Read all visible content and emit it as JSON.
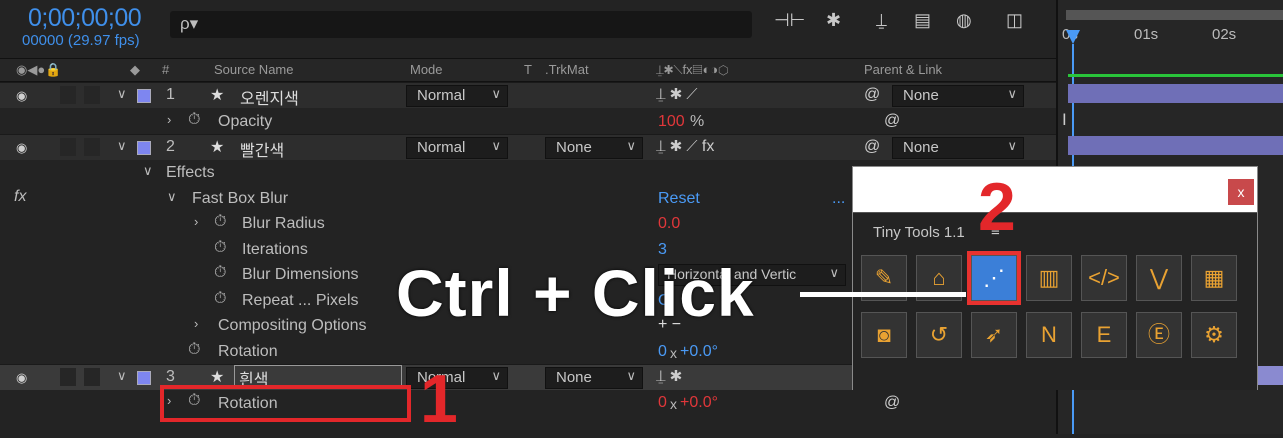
{
  "topbar": {
    "timecode": "0;00;00;00",
    "fps": "00000 (29.97 fps)",
    "search_icon": "ρ▾"
  },
  "columns": {
    "source_name": "Source Name",
    "mode": "Mode",
    "t": "T",
    "trkmat": ".TrkMat",
    "parent_link": "Parent & Link",
    "hash": "#"
  },
  "timeline": {
    "ruler": [
      "0s",
      "01s",
      "02s"
    ],
    "ibeam": "I"
  },
  "layers": [
    {
      "num": "1",
      "name": "오렌지색",
      "mode": "Normal",
      "trkmat": "",
      "parent": "None",
      "color": "#7e86f0"
    },
    {
      "num": "2",
      "name": "빨간색",
      "mode": "Normal",
      "trkmat": "None",
      "parent": "None",
      "color": "#7e86f0"
    },
    {
      "num": "3",
      "name": "흰색",
      "mode": "Normal",
      "trkmat": "None",
      "parent": "",
      "color": "#7e86f0"
    }
  ],
  "props": {
    "opacity_label": "Opacity",
    "opacity_value_num": "100",
    "opacity_value_unit": "%",
    "effects": "Effects",
    "fx": "fx",
    "fast_box_blur": "Fast Box Blur",
    "reset": "Reset",
    "dots": "...",
    "blur_radius": "Blur Radius",
    "blur_radius_value": "0.0",
    "iterations": "Iterations",
    "iterations_value": "3",
    "blur_dimensions": "Blur Dimensions",
    "blur_dimensions_value": "Horizontal and Vertic",
    "repeat_pixels": "Repeat ... Pixels",
    "repeat_value": "O",
    "compositing": "Compositing Options",
    "compositing_value": "+ −",
    "rotation": "Rotation",
    "rotation_value_0": "0",
    "rotation_value_x": "x",
    "rotation_value_rest": "+0.0°",
    "rotation3": "Rotation",
    "rotation3_value_0": "0",
    "rotation3_value_x": "x",
    "rotation3_value_rest": "+0.0°"
  },
  "panel": {
    "title": "Tiny Tools 1.1",
    "close": "x",
    "menu_icon": "≡",
    "icons": [
      {
        "name": "eyedropper-icon",
        "glyph": "✎"
      },
      {
        "name": "broom-icon",
        "glyph": "⌂"
      },
      {
        "name": "link-nodes-icon",
        "glyph": "⋰"
      },
      {
        "name": "film-icon",
        "glyph": "▥"
      },
      {
        "name": "code-icon",
        "glyph": "</>"
      },
      {
        "name": "chevron-collapse-icon",
        "glyph": "⋁"
      },
      {
        "name": "calculator-icon",
        "glyph": "▦"
      },
      {
        "name": "camera-icon",
        "glyph": "◙"
      },
      {
        "name": "history-icon",
        "glyph": "↺"
      },
      {
        "name": "rocket-icon",
        "glyph": "➶"
      },
      {
        "name": "n-loop-icon",
        "glyph": "N"
      },
      {
        "name": "e-cycle-icon",
        "glyph": "E"
      },
      {
        "name": "e-search-icon",
        "glyph": "Ⓔ"
      },
      {
        "name": "settings-gear-icon",
        "glyph": "⚙"
      }
    ]
  },
  "annotations": {
    "instruction": "Ctrl + Click",
    "step1": "1",
    "step2": "2"
  }
}
